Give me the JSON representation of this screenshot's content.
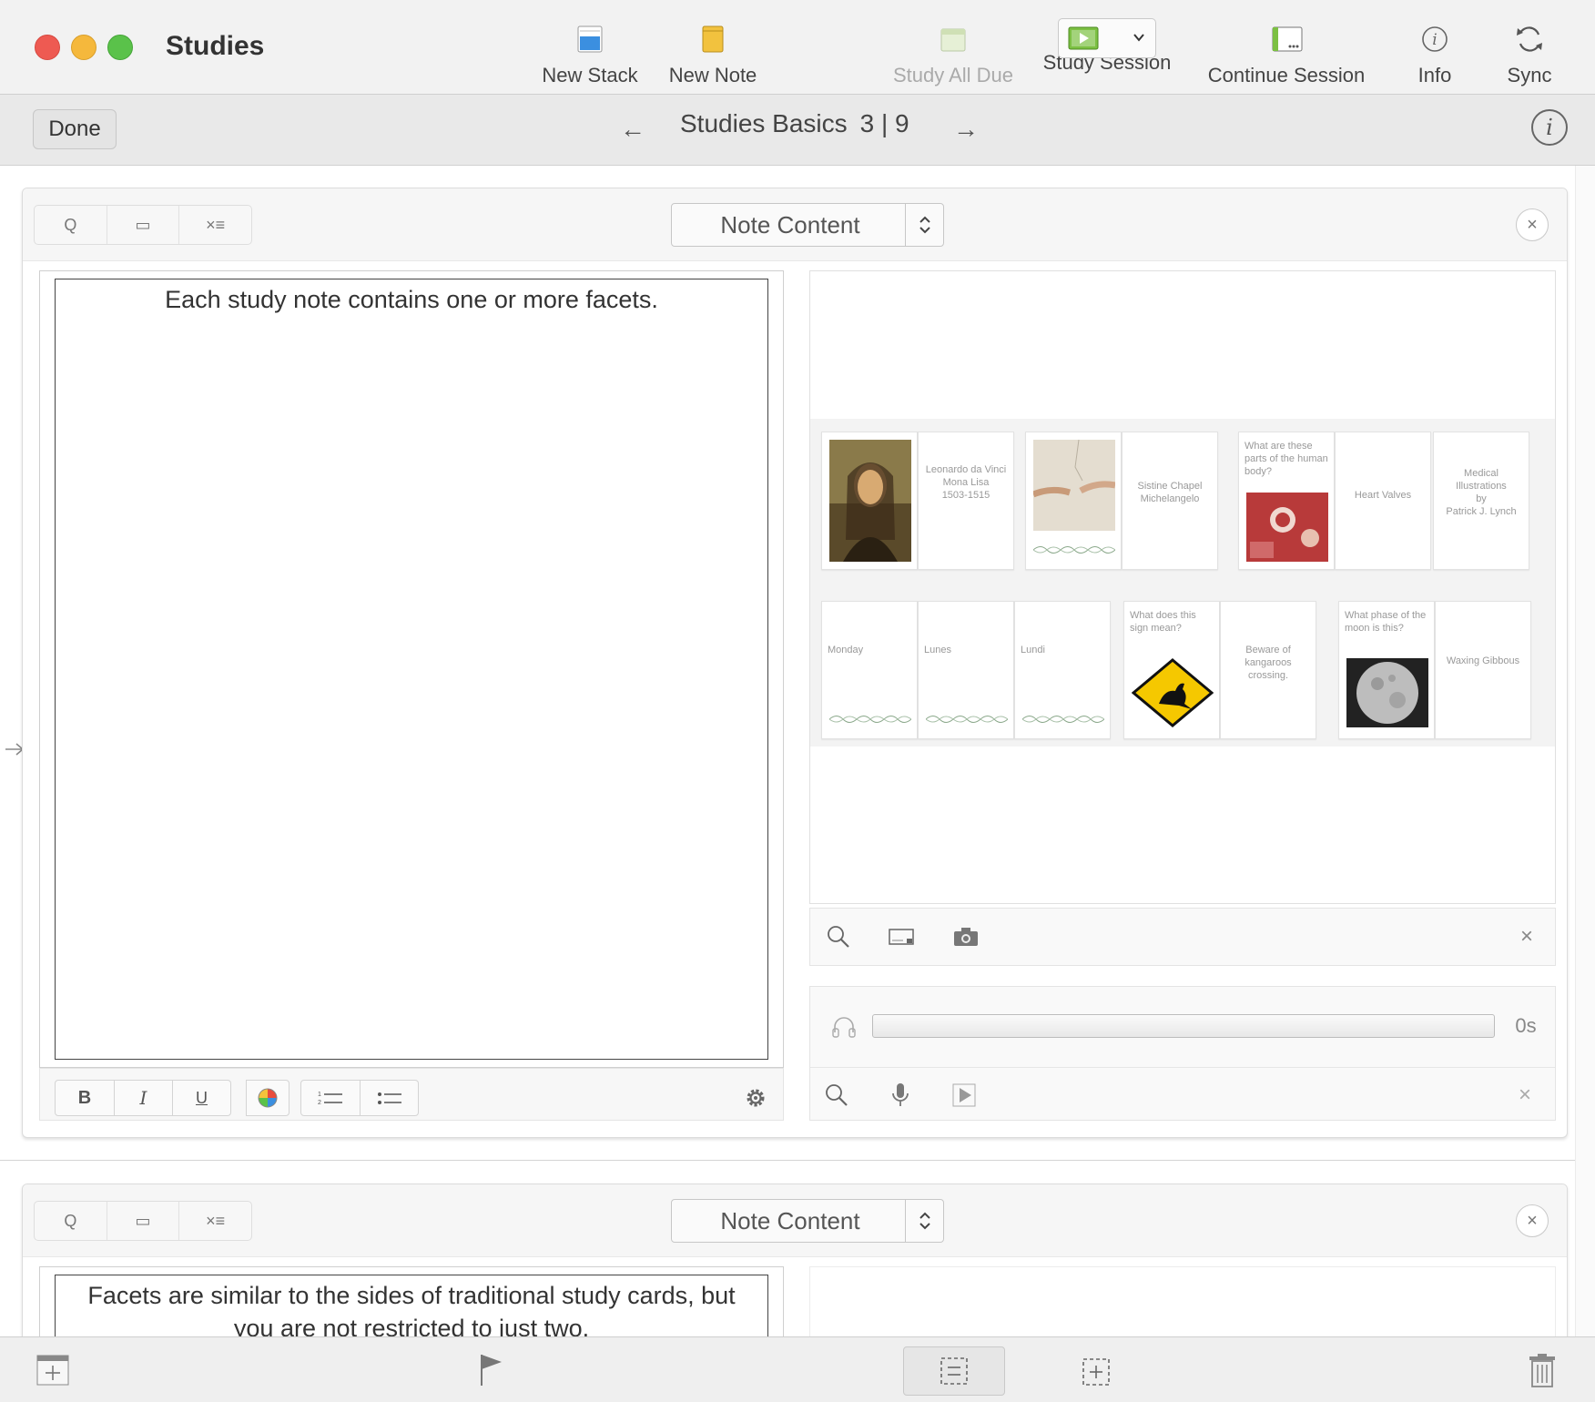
{
  "window": {
    "title": "Studies",
    "traffic_lights": {
      "close": "#ee5a52",
      "minimize": "#f5b83c",
      "zoom": "#5ac24a"
    }
  },
  "toolbar": {
    "new_stack": "New Stack",
    "new_note": "New Note",
    "study_all_due": "Study All Due",
    "study_session": "Study Session",
    "continue_session": "Continue Session",
    "info": "Info",
    "sync": "Sync"
  },
  "navbar": {
    "done": "Done",
    "stack_name": "Studies Basics",
    "position": "3 | 9",
    "prev_arrow": "←",
    "next_arrow": "→"
  },
  "facets": [
    {
      "type_label": "Note Content",
      "text": "Each study note contains one or more facets.",
      "segments": [
        "Q",
        "▭",
        "×≡"
      ]
    },
    {
      "type_label": "Note Content",
      "text": "Facets are similar to the sides of traditional study cards, but you are not restricted to just two.",
      "segments": [
        "Q",
        "▭",
        "×≡"
      ]
    }
  ],
  "format_bar": {
    "bold": "B",
    "italic": "I",
    "underline": "U"
  },
  "media_cards": {
    "row1": [
      {
        "kind": "image",
        "icon": "mona-lisa-image"
      },
      {
        "kind": "text",
        "text": "Leonardo da Vinci\nMona Lisa\n1503-1515"
      },
      {
        "kind": "image",
        "icon": "creation-of-adam-image"
      },
      {
        "kind": "text",
        "text": "Sistine Chapel\nMichelangelo"
      },
      {
        "kind": "question",
        "text": "What are these parts of the human body?",
        "icon": "heart-valves-image"
      },
      {
        "kind": "text",
        "text": "Heart Valves"
      },
      {
        "kind": "text",
        "text": "Medical Illustrations\nby\nPatrick J. Lynch"
      }
    ],
    "row2": [
      {
        "kind": "audio",
        "text": "Monday"
      },
      {
        "kind": "audio",
        "text": "Lunes"
      },
      {
        "kind": "audio",
        "text": "Lundi"
      },
      {
        "kind": "question",
        "text": "What does this sign mean?",
        "icon": "kangaroo-sign-image"
      },
      {
        "kind": "text",
        "text": "Beware of kangaroos crossing."
      },
      {
        "kind": "question",
        "text": "What phase of the moon is this?",
        "icon": "moon-image"
      },
      {
        "kind": "text",
        "text": "Waxing Gibbous"
      }
    ]
  },
  "audio": {
    "duration": "0s"
  },
  "icons": {
    "close": "×",
    "side_toggle": "→",
    "info_glyph": "i"
  },
  "colors": {
    "new_stack_blue": "#3b8fe0",
    "new_note_yellow": "#f2c23e",
    "session_green": "#7cc043"
  }
}
